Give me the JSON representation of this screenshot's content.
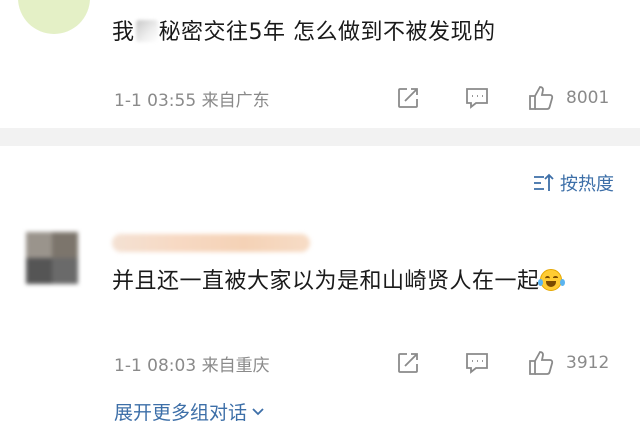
{
  "comment_top": {
    "text_before": "我",
    "text_after": "秘密交往5年 怎么做到不被发现的",
    "time": "1-1 03:55",
    "source": "来自广东",
    "like_count": "8001"
  },
  "sort": {
    "label": "按热度"
  },
  "comment_2": {
    "text": "并且还一直被大家以为是和山崎贤人在一起",
    "time": "1-1 08:03",
    "source": "来自重庆",
    "like_count": "3912"
  },
  "expand": {
    "label": "展开更多组对话"
  },
  "icons": {
    "share": "share-icon",
    "reply": "comment-icon",
    "like": "thumbs-up-icon",
    "sort": "sort-icon",
    "expand": "chevron-down-icon"
  },
  "colors": {
    "link": "#3d6fa8",
    "meta": "#8a8a8a",
    "divider": "#f2f2f2"
  }
}
